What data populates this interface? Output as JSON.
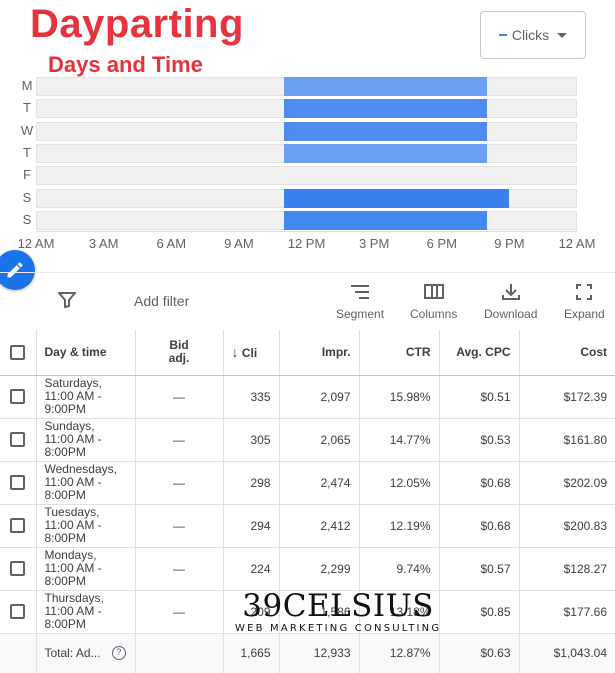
{
  "title": "Dayparting",
  "subtitle": "Days and Time",
  "metric_selector": {
    "label": "Clicks",
    "color": "#4285f4"
  },
  "chart_data": {
    "type": "heatmap",
    "rows": [
      {
        "label": "M",
        "start_hour": 11,
        "end_hour": 20,
        "color": "#6a9ef0"
      },
      {
        "label": "T",
        "start_hour": 11,
        "end_hour": 20,
        "color": "#4e8cf0"
      },
      {
        "label": "W",
        "start_hour": 11,
        "end_hour": 20,
        "color": "#4e8cf0"
      },
      {
        "label": "T",
        "start_hour": 11,
        "end_hour": 20,
        "color": "#6a9ef0"
      },
      {
        "label": "F",
        "start_hour": null,
        "end_hour": null,
        "color": null
      },
      {
        "label": "S",
        "start_hour": 11,
        "end_hour": 21,
        "color": "#3b80ef"
      },
      {
        "label": "S",
        "start_hour": 11,
        "end_hour": 20,
        "color": "#4387f0"
      }
    ],
    "x_ticks": [
      {
        "hour": 0,
        "label": "12 AM"
      },
      {
        "hour": 3,
        "label": "3 AM"
      },
      {
        "hour": 6,
        "label": "6 AM"
      },
      {
        "hour": 9,
        "label": "9 AM"
      },
      {
        "hour": 12,
        "label": "12 PM"
      },
      {
        "hour": 15,
        "label": "3 PM"
      },
      {
        "hour": 18,
        "label": "6 PM"
      },
      {
        "hour": 21,
        "label": "9 PM"
      },
      {
        "hour": 24,
        "label": "12 AM"
      }
    ],
    "xlim": [
      0,
      24
    ]
  },
  "toolbar": {
    "add_filter": "Add filter",
    "segment": "Segment",
    "columns": "Columns",
    "download": "Download",
    "expand": "Expand"
  },
  "table": {
    "headers": {
      "day_time": "Day & time",
      "bid_adj_1": "Bid",
      "bid_adj_2": "adj.",
      "clicks": "Cli",
      "impr": "Impr.",
      "ctr": "CTR",
      "avg_cpc": "Avg. CPC",
      "cost": "Cost"
    },
    "rows": [
      {
        "day1": "Saturdays,",
        "day2": "11:00 AM -",
        "day3": "9:00PM",
        "bid": "—",
        "clicks": "335",
        "impr": "2,097",
        "ctr": "15.98%",
        "cpc": "$0.51",
        "cost": "$172.39"
      },
      {
        "day1": "Sundays,",
        "day2": "11:00 AM -",
        "day3": "8:00PM",
        "bid": "—",
        "clicks": "305",
        "impr": "2,065",
        "ctr": "14.77%",
        "cpc": "$0.53",
        "cost": "$161.80"
      },
      {
        "day1": "Wednesdays,",
        "day2": "11:00 AM -",
        "day3": "8:00PM",
        "bid": "—",
        "clicks": "298",
        "impr": "2,474",
        "ctr": "12.05%",
        "cpc": "$0.68",
        "cost": "$202.09"
      },
      {
        "day1": "Tuesdays,",
        "day2": "11:00 AM -",
        "day3": "8:00PM",
        "bid": "—",
        "clicks": "294",
        "impr": "2,412",
        "ctr": "12.19%",
        "cpc": "$0.68",
        "cost": "$200.83"
      },
      {
        "day1": "Mondays,",
        "day2": "11:00 AM -",
        "day3": "8:00PM",
        "bid": "—",
        "clicks": "224",
        "impr": "2,299",
        "ctr": "9.74%",
        "cpc": "$0.57",
        "cost": "$128.27"
      },
      {
        "day1": "Thursdays,",
        "day2": "11:00 AM -",
        "day3": "8:00PM",
        "bid": "—",
        "clicks": "209",
        "impr": "1,586",
        "ctr": "13.18%",
        "cpc": "$0.85",
        "cost": "$177.66"
      }
    ],
    "total": {
      "label": "Total: Ad...",
      "clicks": "1,665",
      "impr": "12,933",
      "ctr": "12.87%",
      "cpc": "$0.63",
      "cost": "$1,043.04"
    }
  },
  "watermark": {
    "main": "39CELSIUS",
    "sub": "WEB MARKETING CONSULTING"
  }
}
